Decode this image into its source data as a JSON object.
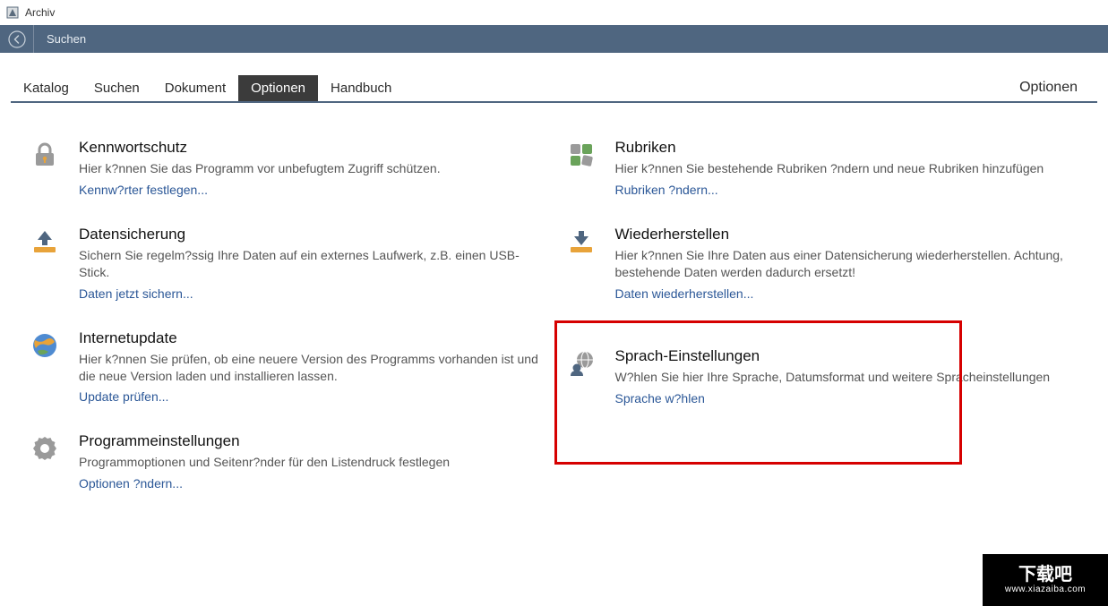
{
  "window": {
    "title": "Archiv"
  },
  "topbar": {
    "search_label": "Suchen"
  },
  "tabs": {
    "items": [
      {
        "label": "Katalog"
      },
      {
        "label": "Suchen"
      },
      {
        "label": "Dokument"
      },
      {
        "label": "Optionen"
      },
      {
        "label": "Handbuch"
      }
    ],
    "right_label": "Optionen"
  },
  "cards_left": [
    {
      "title": "Kennwortschutz",
      "desc": "Hier k?nnen Sie das Programm vor unbefugtem Zugriff schützen.",
      "link": "Kennw?rter festlegen..."
    },
    {
      "title": "Datensicherung",
      "desc": "Sichern Sie regelm?ssig Ihre Daten auf ein externes Laufwerk, z.B. einen USB-Stick.",
      "link": "Daten jetzt sichern..."
    },
    {
      "title": "Internetupdate",
      "desc": "Hier k?nnen Sie prüfen, ob eine neuere Version des Programms vorhanden ist und die neue Version laden und installieren lassen.",
      "link": "Update prüfen..."
    },
    {
      "title": "Programmeinstellungen",
      "desc": "Programmoptionen und Seitenr?nder für den Listendruck festlegen",
      "link": "Optionen ?ndern..."
    }
  ],
  "cards_right": [
    {
      "title": "Rubriken",
      "desc": "Hier k?nnen Sie bestehende Rubriken ?ndern und neue Rubriken hinzufügen",
      "link": "Rubriken ?ndern..."
    },
    {
      "title": "Wiederherstellen",
      "desc": "Hier k?nnen Sie Ihre Daten aus einer Datensicherung wiederherstellen. Achtung, bestehende Daten werden dadurch ersetzt!",
      "link": "Daten wiederherstellen..."
    },
    {
      "title": "Sprach-Einstellungen",
      "desc": "W?hlen Sie hier Ihre Sprache, Datumsformat und weitere Spracheinstellungen",
      "link": "Sprache w?hlen"
    }
  ],
  "watermark": {
    "title": "下载吧",
    "url": "www.xiazaiba.com"
  }
}
